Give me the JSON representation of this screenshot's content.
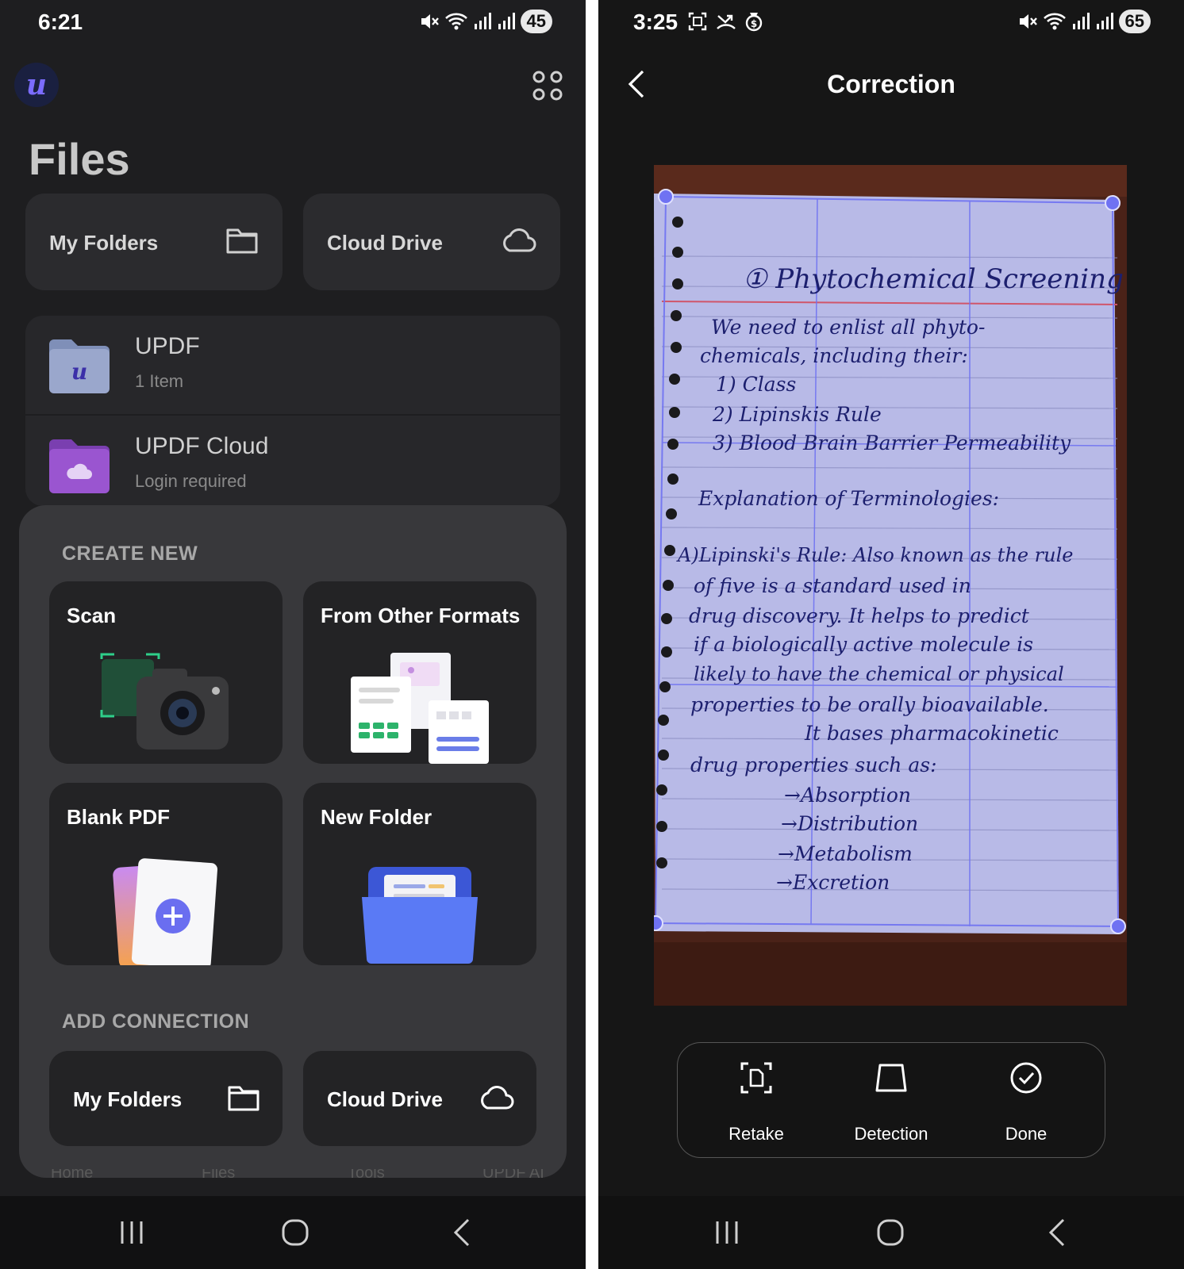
{
  "left": {
    "status": {
      "time": "6:21",
      "battery": "45"
    },
    "title": "Files",
    "top_tiles": [
      {
        "label": "My Folders",
        "icon": "folder-icon"
      },
      {
        "label": "Cloud Drive",
        "icon": "cloud-icon"
      }
    ],
    "files": [
      {
        "name": "UPDF",
        "sub": "1 Item",
        "icon": "updf-folder-icon"
      },
      {
        "name": "UPDF Cloud",
        "sub": "Login required",
        "icon": "cloud-folder-icon"
      }
    ],
    "create_new": {
      "heading": "CREATE NEW",
      "items": [
        {
          "label": "Scan",
          "icon": "camera-scan-icon"
        },
        {
          "label": "From Other Formats",
          "icon": "documents-icon"
        },
        {
          "label": "Blank PDF",
          "icon": "blank-pdf-icon"
        },
        {
          "label": "New Folder",
          "icon": "new-folder-icon"
        }
      ]
    },
    "add_connection": {
      "heading": "ADD CONNECTION",
      "items": [
        {
          "label": "My Folders",
          "icon": "folder-icon"
        },
        {
          "label": "Cloud Drive",
          "icon": "cloud-icon"
        }
      ]
    },
    "tabs": [
      "Home",
      "Files",
      "Tools",
      "UPDF AI"
    ]
  },
  "right": {
    "status": {
      "time": "3:25",
      "battery": "65"
    },
    "title": "Correction",
    "document_lines": [
      "① Phytochemical Screening",
      "We need to enlist all phyto-",
      "chemicals, including their:",
      "1) Class",
      "2) Lipinskis Rule",
      "3) Blood Brain Barrier Permeability",
      "Explanation of Terminologies:",
      "A)Lipinski's Rule: Also known as the rule",
      "of five is a standard used in",
      "drug discovery. It helps to predict",
      "if a biologically active molecule is",
      "likely to have the chemical or physical",
      "properties to be orally bioavailable.",
      "It bases pharmacokinetic",
      "drug properties such as:",
      "→Absorption",
      "→Distribution",
      "→Metabolism",
      "→Excretion"
    ],
    "tools": [
      {
        "label": "Retake",
        "icon": "retake-icon"
      },
      {
        "label": "Detection",
        "icon": "detection-icon"
      },
      {
        "label": "Done",
        "icon": "done-check-icon"
      }
    ]
  },
  "colors": {
    "accent": "#6f72f2",
    "left_bg": "#1e1e20",
    "right_bg": "#161616",
    "paper": "#b9bbe8",
    "ink": "#1c1f6e"
  }
}
